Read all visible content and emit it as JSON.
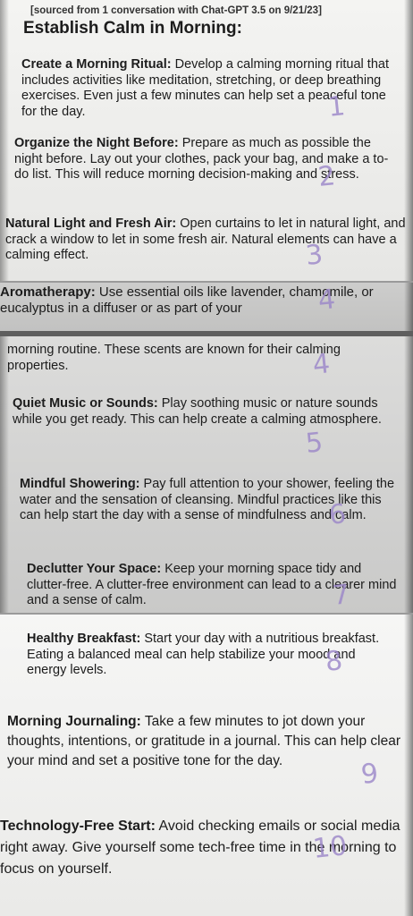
{
  "source_note": "[sourced from 1 conversation with Chat-GPT 3.5 on 9/21/23]",
  "title": "Establish Calm in Morning:",
  "items": [
    {
      "heading": "Create a Morning Ritual:",
      "text": "Develop a calming morning ritual that includes activities like meditation, stretching, or deep breathing exercises. Even just a few minutes can help set a peaceful tone for the day.",
      "mark": "1"
    },
    {
      "heading": "Organize the Night Before:",
      "text": "Prepare as much as possible the night before. Lay out your clothes, pack your bag, and make a to-do list. This will reduce morning decision-making and stress.",
      "mark": "2"
    },
    {
      "heading": "Natural Light and Fresh Air:",
      "text": "Open curtains to let in natural light, and crack a window to let in some fresh air. Natural elements can have a calming effect.",
      "mark": "3"
    },
    {
      "heading": "Aromatherapy:",
      "text": "Use essential oils like lavender, chamomile, or eucalyptus in a diffuser or as part of your",
      "mark": "4"
    },
    {
      "heading": "",
      "text": "morning routine. These scents are known for their calming properties.",
      "mark": "4"
    },
    {
      "heading": "Quiet Music or Sounds:",
      "text": "Play soothing music or nature sounds while you get ready. This can help create a calming atmosphere.",
      "mark": "5"
    },
    {
      "heading": "Mindful Showering:",
      "text": "Pay full attention to your shower, feeling the water and the sensation of cleansing. Mindful practices like this can help start the day with a sense of mindfulness and calm.",
      "mark": "6"
    },
    {
      "heading": "Declutter Your Space:",
      "text": "Keep your morning space tidy and clutter-free. A clutter-free environment can lead to a clearer mind and a sense of calm.",
      "mark": "7"
    },
    {
      "heading": "Healthy Breakfast:",
      "text": "Start your day with a nutritious breakfast. Eating a balanced meal can help stabilize your mood and energy levels.",
      "mark": "8"
    },
    {
      "heading": "Morning Journaling:",
      "text": "Take a few minutes to jot down your thoughts, intentions, or gratitude in a journal. This can help clear your mind and set a positive tone for the day.",
      "mark": "9"
    },
    {
      "heading": "Technology-Free Start:",
      "text": "Avoid checking emails or social media right away. Give yourself some tech-free time in the morning to focus on yourself.",
      "mark": "10"
    }
  ]
}
